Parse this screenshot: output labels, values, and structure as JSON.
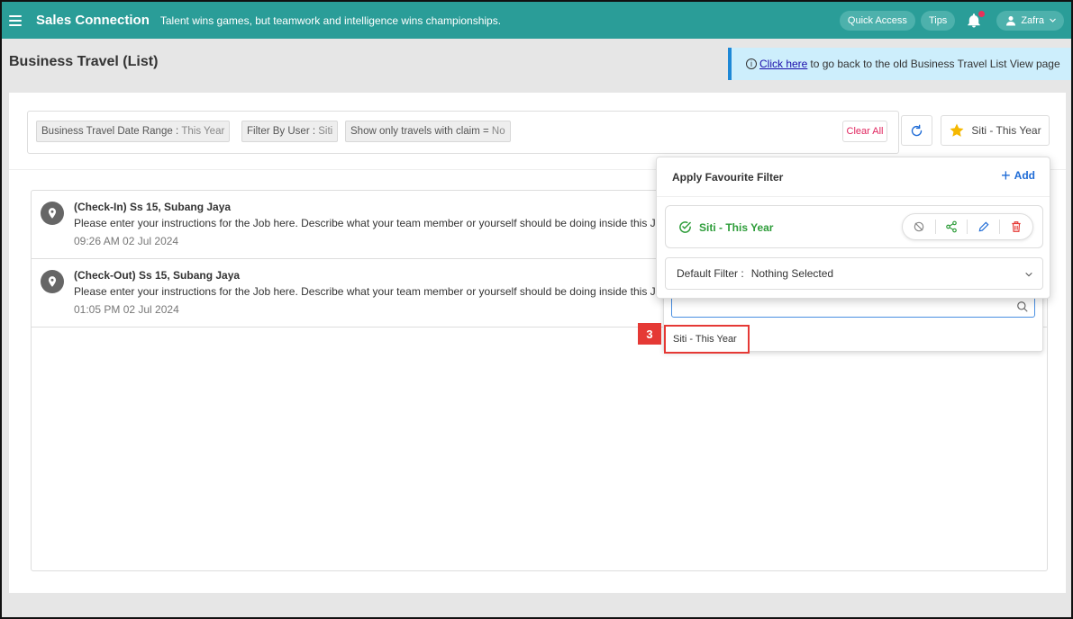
{
  "topbar": {
    "brand": "Sales Connection",
    "slogan": "Talent wins games, but teamwork and intelligence wins championships.",
    "quick_access": "Quick Access",
    "tips": "Tips",
    "user": "Zafra"
  },
  "header": {
    "title": "Business Travel (List)",
    "old_link_text": "Click here",
    "old_link_rest": "to go back to the old Business Travel List View page"
  },
  "filters": {
    "chips": [
      {
        "label": "Business Travel Date Range :",
        "value": "This Year"
      },
      {
        "label": "Filter By User :",
        "value": "Siti"
      },
      {
        "label": "Show only travels with claim =",
        "value": "No"
      }
    ],
    "clear_all": "Clear All",
    "favourite_button": "Siti - This Year"
  },
  "list": [
    {
      "title": "(Check-In) Ss 15, Subang Jaya",
      "desc": "Please enter your instructions for the Job here. Describe what your team member or yourself should be doing inside this Job",
      "time": "09:26 AM  02 Jul 2024"
    },
    {
      "title": "(Check-Out) Ss 15, Subang Jaya",
      "desc": "Please enter your instructions for the Job here. Describe what your team member or yourself should be doing inside this Job",
      "time": "01:05 PM  02 Jul 2024"
    }
  ],
  "fav_panel": {
    "title": "Apply Favourite Filter",
    "add": "Add",
    "item_name": "Siti - This Year",
    "default_label": "Default Filter :",
    "default_value": "Nothing Selected"
  },
  "dropdown": {
    "search_value": "",
    "option": "Siti - This Year"
  },
  "step_badge": "3",
  "colors": {
    "topbar": "#2a9d98",
    "accent_blue": "#1e6bd6",
    "success_green": "#2e9d3a",
    "danger_red": "#e53935",
    "star": "#f5b800"
  }
}
